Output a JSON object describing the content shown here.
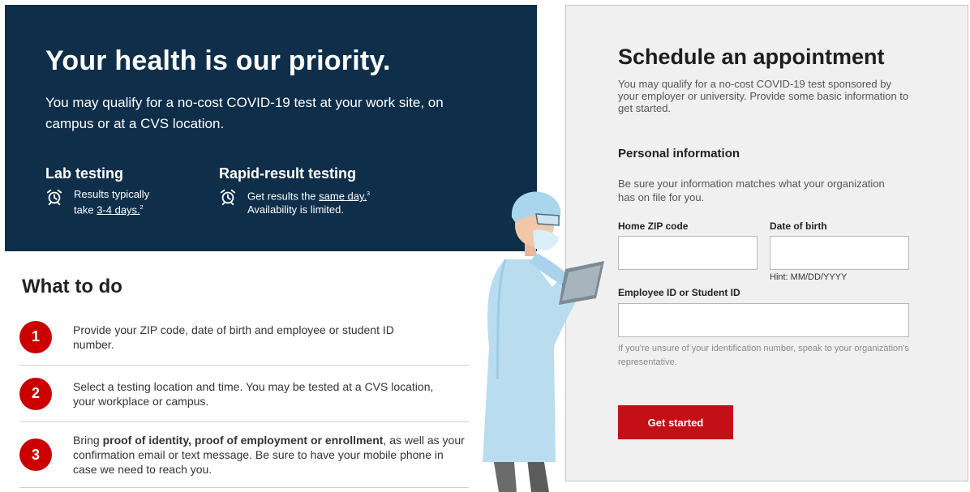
{
  "hero": {
    "title": "Your health is our priority.",
    "description": "You may qualify for a no-cost COVID-19 test at your work site, on campus or at a CVS location.",
    "lab": {
      "title": "Lab testing",
      "text_before": "Results typically take ",
      "link": "3-4 days.",
      "footnote": "2"
    },
    "rapid": {
      "title": "Rapid-result testing",
      "text_before": "Get results the ",
      "link": "same day.",
      "footnote": "3",
      "text_after": "Availability is limited."
    }
  },
  "what_to_do": {
    "title": "What to do",
    "steps": [
      {
        "number": "1",
        "text": "Provide your ZIP code, date of birth and employee or student ID number."
      },
      {
        "number": "2",
        "text": "Select a testing location and time. You may be tested at a CVS location, your workplace or campus."
      },
      {
        "number": "3",
        "bold": "proof of identity, proof of employment or enrollment",
        "text_before": "Bring ",
        "text_after": ", as well as your confirmation email or text message. Be sure to have your mobile phone in case we need to reach you."
      }
    ]
  },
  "form": {
    "title": "Schedule an appointment",
    "description": "You may qualify for a no-cost COVID-19 test sponsored by your employer or university. Provide some basic information to get started.",
    "section_title": "Personal information",
    "section_description": "Be sure your information matches what your organization has on file for you.",
    "zip": {
      "label": "Home ZIP code",
      "value": ""
    },
    "dob": {
      "label": "Date of birth",
      "value": "",
      "hint": "Hint: MM/DD/YYYY"
    },
    "employee_id": {
      "label": "Employee ID or Student ID",
      "value": ""
    },
    "help": "If you're unsure of your identification number, speak to your organization's representative.",
    "button": "Get started"
  },
  "icons": {
    "lab": "alarm-clock-icon",
    "rapid": "alarm-clock-icon"
  },
  "colors": {
    "hero_bg": "#0e2e4a",
    "accent_red": "#cc0000",
    "button_red": "#c40f17",
    "panel_bg": "#f0f0f0"
  }
}
